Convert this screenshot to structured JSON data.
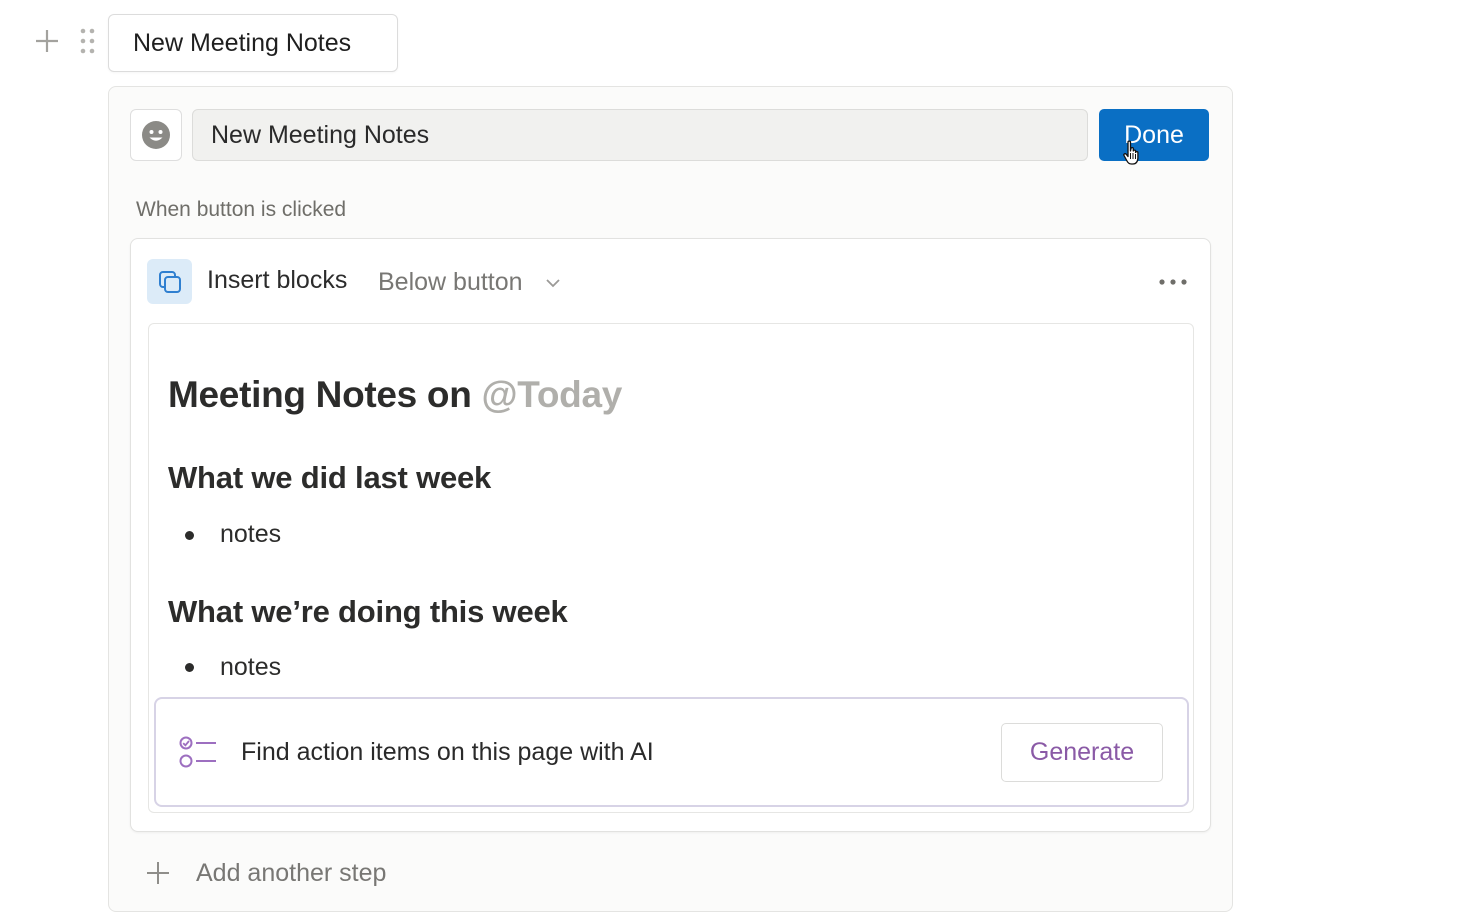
{
  "block": {
    "button_label": "New Meeting Notes",
    "add_icon": "plus-icon",
    "drag_icon": "drag-handle-icon"
  },
  "editor": {
    "emoji_icon": "smiley-face-icon",
    "name_value": "New Meeting Notes",
    "done_label": "Done",
    "trigger_label": "When button is clicked"
  },
  "step": {
    "icon": "copy-blocks-icon",
    "title": "Insert blocks",
    "position": "Below button",
    "more_icon": "more-horizontal-icon"
  },
  "template": {
    "heading": "Meeting Notes on ",
    "mention": "@Today",
    "sections": [
      {
        "heading": "What we did last week",
        "bullet": "notes"
      },
      {
        "heading": "What we’re doing this week",
        "bullet": "notes"
      }
    ],
    "ai_block": {
      "icon": "checklist-icon",
      "text": "Find action items on this page with AI",
      "generate_label": "Generate"
    }
  },
  "add_step": {
    "label": "Add another step"
  },
  "colors": {
    "done_button": "#0a6fc4",
    "generate_text": "#8a5aa6",
    "ai_icon": "#9d6fc0",
    "step_icon_bg": "#dcebf8"
  }
}
